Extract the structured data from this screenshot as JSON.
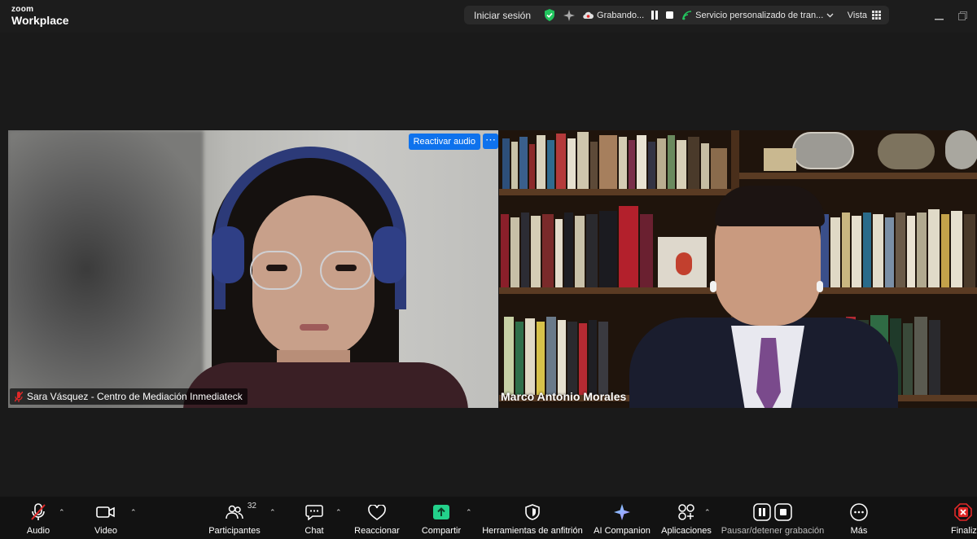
{
  "app": {
    "brand_small": "zoom",
    "brand_large": "Workplace"
  },
  "topbar": {
    "sign_in": "Iniciar sesión",
    "recording": "Grabando...",
    "service": "Servicio personalizado de tran...",
    "view": "Vista"
  },
  "tiles": {
    "left": {
      "name": "Sara Vásquez - Centro de Mediación Inmediateck",
      "reactivate_audio": "Reactivar audio",
      "more": "⋯"
    },
    "right": {
      "name": "Marco Antonio Morales"
    }
  },
  "toolbar": {
    "audio": "Audio",
    "video": "Video",
    "participants": "Participantes",
    "participants_count": "32",
    "chat": "Chat",
    "react": "Reaccionar",
    "share": "Compartir",
    "host_tools": "Herramientas de anfitrión",
    "ai_companion": "AI Companion",
    "apps": "Aplicaciones",
    "pause_stop_recording": "Pausar/detener grabación",
    "more": "Más",
    "end": "Finaliza"
  },
  "colors": {
    "accent_blue": "#0e72ed",
    "share_green": "#23d18b",
    "end_red": "#e02828",
    "security_green": "#22c55e"
  }
}
